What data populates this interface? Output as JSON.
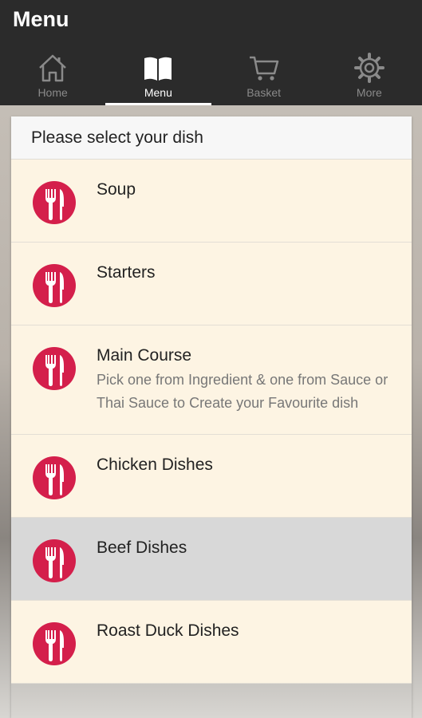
{
  "app": {
    "title": "Menu"
  },
  "tabs": [
    {
      "label": "Home",
      "icon": "home-icon",
      "active": false
    },
    {
      "label": "Menu",
      "icon": "book-icon",
      "active": true
    },
    {
      "label": "Basket",
      "icon": "cart-icon",
      "active": false
    },
    {
      "label": "More",
      "icon": "gear-icon",
      "active": false
    }
  ],
  "panel": {
    "header": "Please select your dish",
    "items": [
      {
        "title": "Soup",
        "subtitle": "",
        "icon": "cutlery-icon"
      },
      {
        "title": "Starters",
        "subtitle": "",
        "icon": "cutlery-icon"
      },
      {
        "title": "Main Course",
        "subtitle": "Pick one from Ingredient & one from Sauce or Thai Sauce to Create your Favourite dish",
        "icon": "cutlery-icon"
      },
      {
        "title": "Chicken Dishes",
        "subtitle": "",
        "icon": "cutlery-icon"
      },
      {
        "title": "Beef Dishes",
        "subtitle": "",
        "icon": "cutlery-icon",
        "selected": true
      },
      {
        "title": "Roast Duck Dishes",
        "subtitle": "",
        "icon": "cutlery-icon"
      }
    ]
  },
  "colors": {
    "appbar": "#2b2b2b",
    "accent": "#d41f4b",
    "row_bg": "#fdf4e3",
    "row_selected": "#d8d8d8"
  }
}
